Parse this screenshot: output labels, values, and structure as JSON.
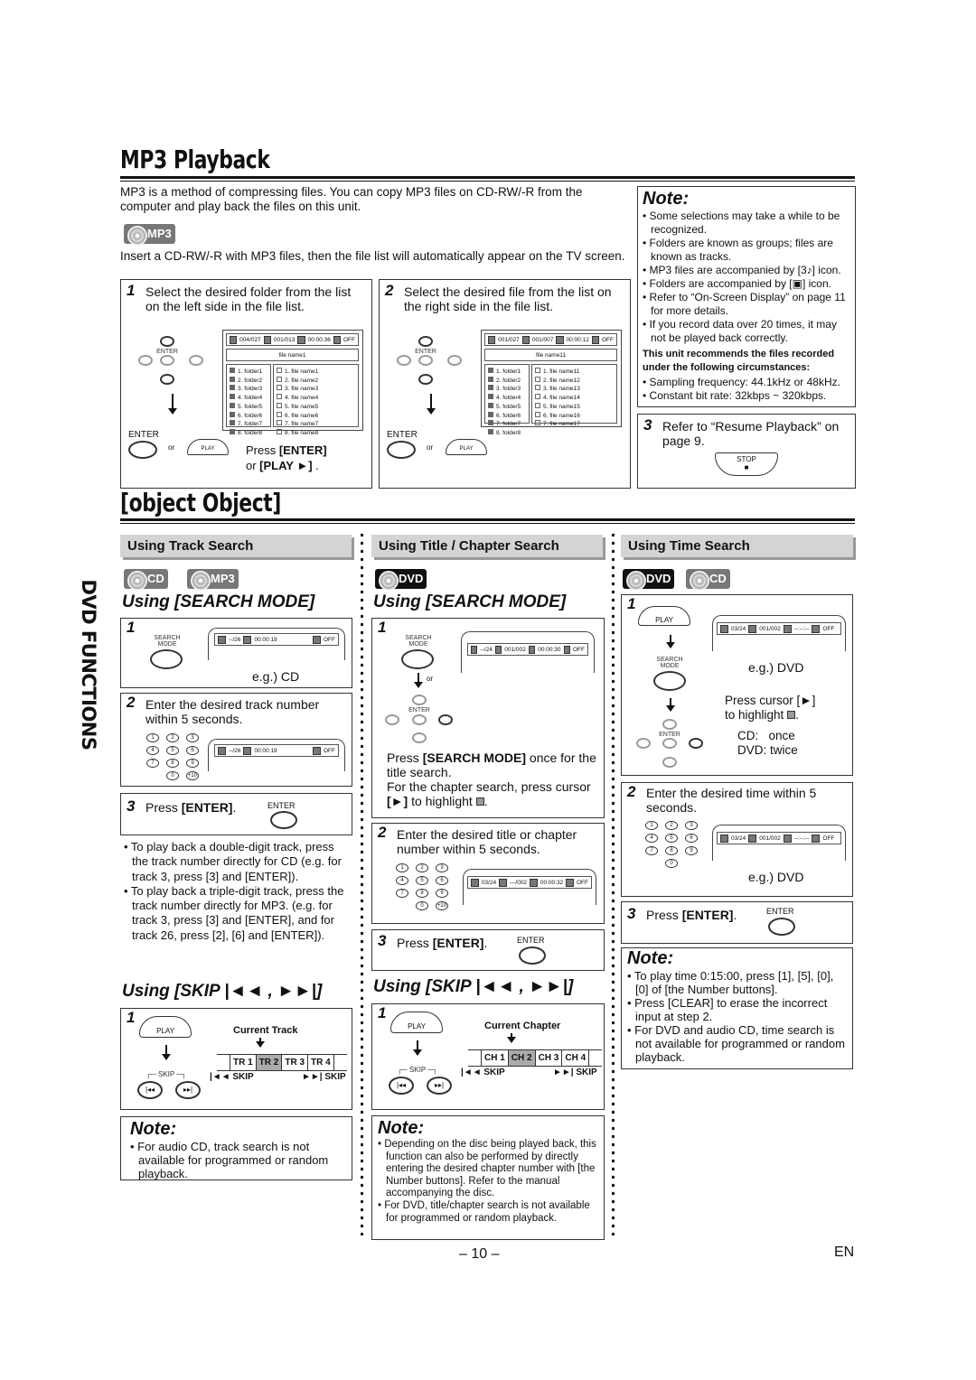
{
  "mp3": {
    "title": "MP3 Playback",
    "intro": "MP3 is a method of compressing files. You can copy MP3 files on CD-RW/-R from the computer and play back the files on this unit.",
    "badge": "MP3",
    "insert": "Insert a CD-RW/-R with MP3 files, then the file list will automatically appear on the TV screen.",
    "step1": {
      "num": "1",
      "text": "Select the desired folder from the list on the left side in the file list.",
      "osd": [
        "004/027",
        "001/013",
        "00:00:36",
        "OFF"
      ],
      "current": "file name1",
      "folders": [
        "1. folder1",
        "2. folder2",
        "3. folder3",
        "4. folder4",
        "5. folder5",
        "6. folder6",
        "7. folder7",
        "8. folder8"
      ],
      "files": [
        "1. file name1",
        "2. file name2",
        "3. file name3",
        "4. file name4",
        "5. file name5",
        "6. file name6",
        "7. file name7",
        "8. file name8"
      ],
      "enter": "ENTER",
      "or": "or",
      "play": "PLAY",
      "press1": "Press ",
      "press1b": "[ENTER]",
      "press2": "or ",
      "press2b": "[PLAY ►]",
      "press2c": " ."
    },
    "step2": {
      "num": "2",
      "text": "Select the desired file from the list on the right side in the file list.",
      "osd": [
        "001/027",
        "001/007",
        "00:00:12",
        "OFF"
      ],
      "current": "file name11",
      "folders": [
        "1. folder1",
        "2. folder2",
        "3. folder3",
        "4. folder4",
        "5. folder5",
        "6. folder6",
        "7. folder7",
        "8. folder8"
      ],
      "files": [
        "1. file name11",
        "2. file name12",
        "3. file name13",
        "4. file name14",
        "5. file name15",
        "6. file name16",
        "7. file name17"
      ],
      "enter": "ENTER",
      "or": "or",
      "play": "PLAY"
    },
    "note": {
      "title": "Note:",
      "items": [
        "• Some selections may take a while to be recognized.",
        "• Folders are known as groups; files are known as tracks.",
        "• MP3 files are accompanied by [3♪] icon.",
        "• Folders are accompanied by [▣] icon.",
        "• Refer to “On-Screen Display” on page 11 for more details.",
        "• If you record data over 20 times, it may not be played back correctly."
      ],
      "bold": "This unit recommends the files recorded under the following circumstances:",
      "items2": [
        "• Sampling frequency: 44.1kHz or 48kHz.",
        "• Constant bit rate: 32kbps ~ 320kbps."
      ]
    },
    "step3": {
      "num": "3",
      "text": "Refer to “Resume Playback” on page 9.",
      "stop": "STOP"
    }
  },
  "search": {
    "title": {
      "header": "Using Title / Chapter Search",
      "badges": [
        "DVD"
      ],
      "mode": "Using [SEARCH MODE]",
      "s1": {
        "num": "1",
        "osd": [
          "T",
          "--/24",
          "001/002",
          "00:00:30",
          "OFF"
        ],
        "t1": "Press ",
        "b1": "[SEARCH MODE]",
        "t2": " once for the title search.",
        "t3": "For the chapter search, press cursor ",
        "b2": "[►]",
        "t4": " to highlight ",
        "t5": "."
      },
      "s2": {
        "num": "2",
        "text": "Enter the desired title or chapter number within 5 seconds.",
        "osd": [
          "T",
          "03/24",
          "---/002",
          "00:00:32",
          "OFF"
        ]
      },
      "s3": {
        "num": "3",
        "text": "Press ",
        "bold": "[ENTER]",
        "tail": "."
      },
      "skip_title": "Using [SKIP |◄◄ , ►►|]",
      "skip": {
        "num": "1",
        "label": "Current Chapter",
        "cells": [
          "CH 1",
          "CH 2",
          "CH 3",
          "CH 4"
        ],
        "current": 1,
        "prev": "|◄◄ SKIP",
        "next": "►►| SKIP"
      },
      "note": {
        "title": "Note:",
        "items": [
          "• Depending on the disc being played back, this function can also be performed by directly entering the desired chapter number with [the Number buttons]. Refer to the manual accompanying the disc.",
          "• For DVD, title/chapter search is not available for programmed or random playback."
        ]
      }
    },
    "side_tab": "DVD FUNCTIONS",
    "remote": {
      "enter": "ENTER",
      "search_mode": "SEARCH\nMODE",
      "play": "PLAY",
      "skip": "SKIP",
      "or": "or",
      "keys": [
        "1",
        "2",
        "3",
        "4",
        "5",
        "6",
        "7",
        "8",
        "9",
        "0",
        "+10"
      ]
    },
    "track": {
      "header": "Using Track Search",
      "badges": [
        "CD",
        "MP3"
      ],
      "mode": "Using [SEARCH MODE]",
      "s1": {
        "num": "1",
        "osd": [
          "TR",
          "--/26",
          "00:00:19",
          "OFF"
        ],
        "eg": "e.g.) CD"
      },
      "s2": {
        "num": "2",
        "text": "Enter the desired track number within 5 seconds.",
        "osd": [
          "TR",
          "--/26",
          "00:00:19",
          "OFF"
        ]
      },
      "s3": {
        "num": "3",
        "text": "Press ",
        "bold": "[ENTER]",
        "tail": "."
      },
      "bullets": [
        "• To play back a double-digit track, press the track number directly for CD (e.g. for track 3, press [3] and [ENTER]).",
        "• To play back a triple-digit track, press the track number directly for MP3. (e.g. for track 3, press [3] and [ENTER], and for track 26, press [2], [6] and [ENTER])."
      ],
      "skip_title": "Using [SKIP |◄◄ , ►►|]",
      "skip": {
        "num": "1",
        "label": "Current Track",
        "cells": [
          "TR 1",
          "TR 2",
          "TR 3",
          "TR 4"
        ],
        "current": 1,
        "prev": "|◄◄ SKIP",
        "next": "►►| SKIP"
      },
      "note": {
        "title": "Note:",
        "text": "• For audio CD, track search is not available for programmed or random playback."
      }
    },
    "time": {
      "header": "Using Time Search",
      "badges": [
        "DVD",
        "CD"
      ],
      "s1": {
        "num": "1",
        "osd": [
          "T",
          "03/24",
          "001/002",
          "--:--:--",
          "OFF"
        ],
        "eg": "e.g.) DVD",
        "c1": "Press cursor [►]",
        "c2": "to highlight ",
        "cd": "CD:   once",
        "dvd": "DVD: twice"
      },
      "s2": {
        "num": "2",
        "text": "Enter the desired time within 5 seconds.",
        "osd": [
          "T",
          "03/24",
          "001/002",
          "--:--:--",
          "OFF"
        ],
        "eg": "e.g.) DVD"
      },
      "s3": {
        "num": "3",
        "text": "Press ",
        "bold": "[ENTER]",
        "tail": "."
      },
      "note": {
        "title": "Note:",
        "items": [
          "• To play time 0:15:00, press [1], [5], [0], [0] of [the Number buttons].",
          "• Press [CLEAR] to erase the incorrect input at step 2.",
          "• For DVD and audio CD, time search is not available for programmed or random playback."
        ]
      }
    }
  },
  "footer": {
    "page": "– 10 –",
    "lang": "EN"
  }
}
